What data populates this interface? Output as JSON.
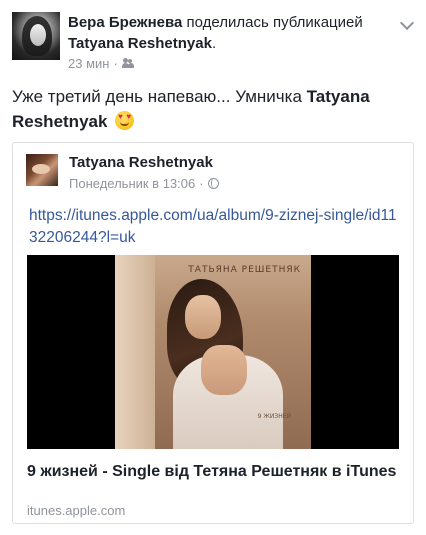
{
  "post": {
    "author": "Вера Брежнева",
    "action": "поделилась публикацией",
    "shared_author": "Tatyana Reshetnyak",
    "time": "23 мин",
    "separator": "·",
    "privacy_icon": "friends-icon",
    "body_prefix": "Уже третий день напеваю... Умничка",
    "body_mention": "Tatyana Reshetnyak",
    "emoji": "heart-eyes-emoji"
  },
  "shared": {
    "name": "Tatyana Reshetnyak",
    "time": "Понедельник в 13:06",
    "separator": "·",
    "privacy_icon": "globe-icon",
    "link": "https://itunes.apple.com/ua/album/9-ziznej-single/id1132206244?l=uk",
    "cover_title": "ТАТЬЯНА РЕШЕТНЯК",
    "cover_sub": "9 ЖИЗНЕЙ",
    "title": "9 жизней - Single від Тетяна Решетняк в iTunes",
    "domain": "itunes.apple.com"
  },
  "colors": {
    "text": "#1d2129",
    "secondary": "#90949c",
    "link": "#365899",
    "border": "#dddfe2"
  }
}
